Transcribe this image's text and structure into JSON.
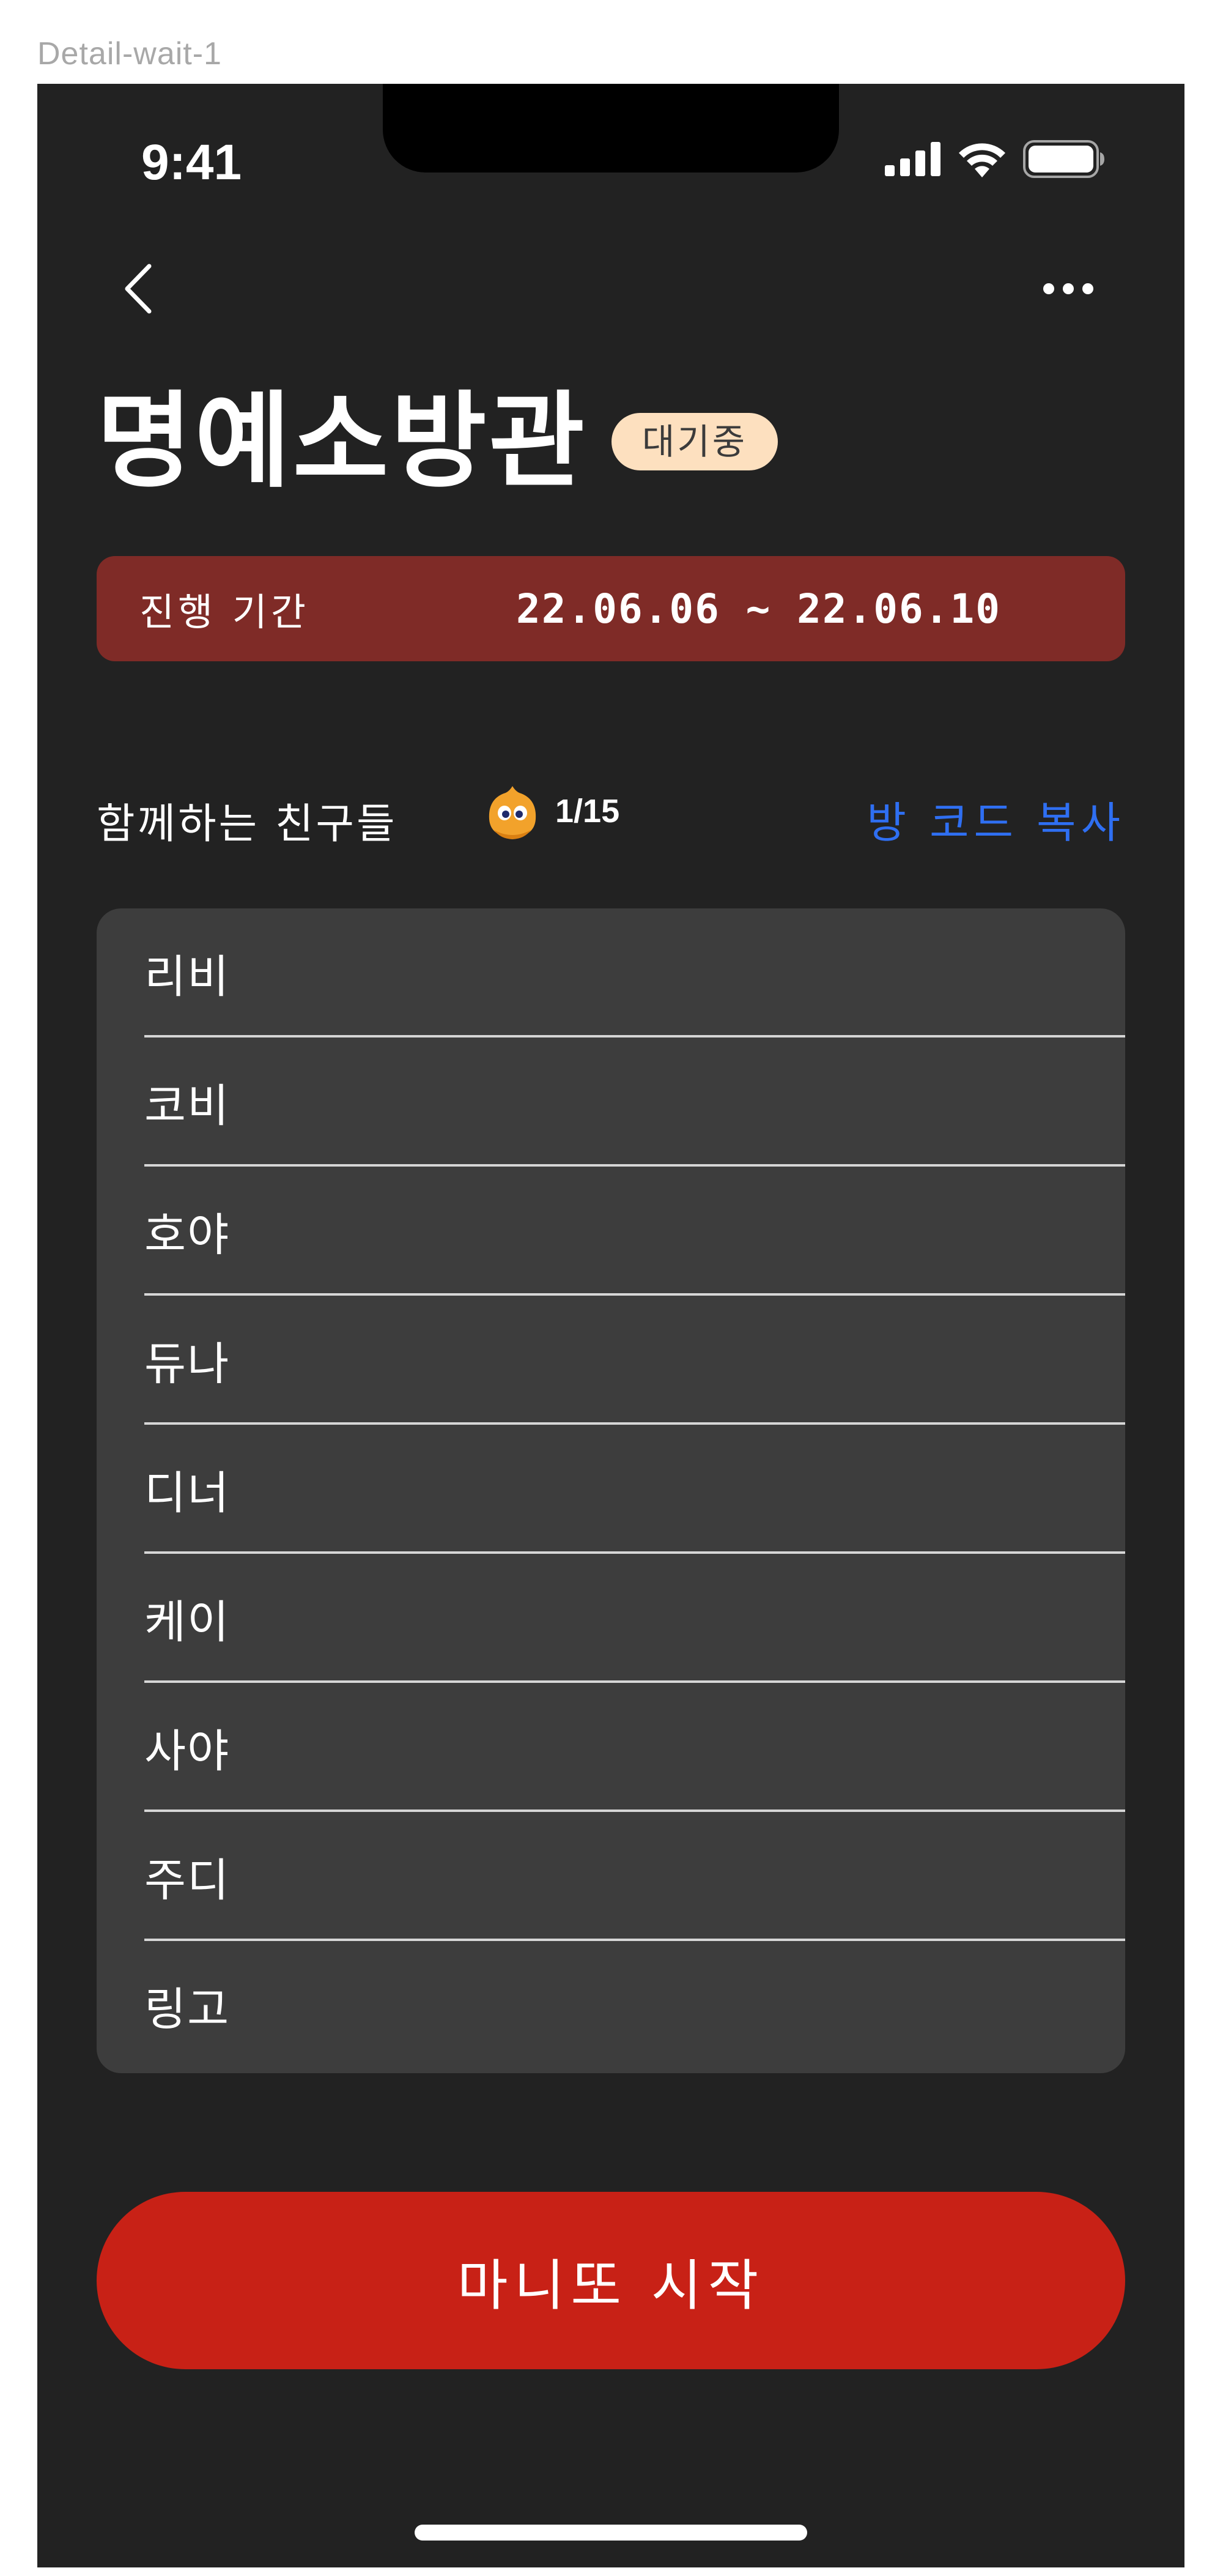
{
  "frame_label": "Detail-wait-1",
  "status_bar": {
    "time": "9:41"
  },
  "header": {
    "title": "명예소방관",
    "badge": "대기중"
  },
  "period": {
    "label": "진행 기간",
    "value": "22.06.06 ~ 22.06.10"
  },
  "friends": {
    "title": "함께하는 친구들",
    "count": "1/15",
    "copy_code_label": "방 코드 복사",
    "items": [
      {
        "name": "리비"
      },
      {
        "name": "코비"
      },
      {
        "name": "호야"
      },
      {
        "name": "듀나"
      },
      {
        "name": "디너"
      },
      {
        "name": "케이"
      },
      {
        "name": "사야"
      },
      {
        "name": "주디"
      },
      {
        "name": "링고"
      }
    ]
  },
  "cta": {
    "start_label": "마니또 시작"
  },
  "icons": {
    "back": "chevron-left-icon",
    "more": "more-horizontal-icon",
    "signal": "cellular-signal-icon",
    "wifi": "wifi-icon",
    "battery": "battery-icon",
    "mascot": "mascot-icon"
  },
  "colors": {
    "background": "#222222",
    "period_box": "#7f2b27",
    "badge": "#fde0bf",
    "list_bg": "#3d3d3d",
    "accent_link": "#2f6ff2",
    "cta": "#c82116"
  }
}
